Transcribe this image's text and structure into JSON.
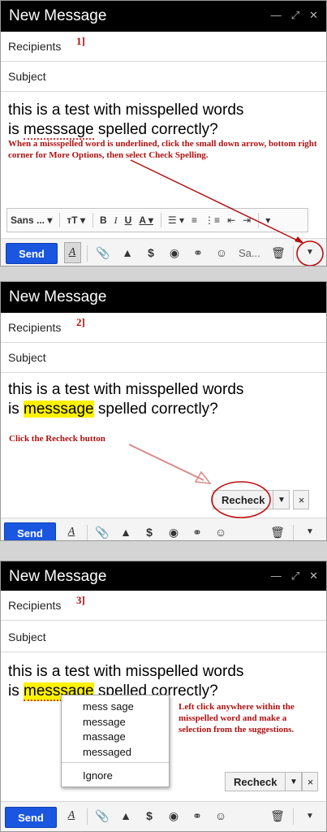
{
  "window_title": "New Message",
  "fields": {
    "recipients": "Recipients",
    "subject": "Subject"
  },
  "steps": [
    "1]",
    "2]",
    "3]"
  ],
  "body": {
    "line1": "this is a test with misspelled words",
    "line2_prefix": "is ",
    "misspelled": "messsage",
    "line2_suffix": " spelled correctly?"
  },
  "annotations": {
    "step1": "When a missspelled word is underlined, click the small down arrow, bottom right corner for More Options, then select Check Spelling.",
    "step2": "Click the Recheck button",
    "step3": "Left click anywhere within the misspelled word and make a selection from the suggestions."
  },
  "format_toolbar": {
    "font": "Sans ...",
    "size": "тT",
    "bold": "B",
    "italic": "I",
    "underline": "U",
    "text_color": "A"
  },
  "toolbar": {
    "send": "Send",
    "format_icon": "A",
    "dollar": "$",
    "sans_truncated": "Sa..."
  },
  "spellcheck": {
    "recheck": "Recheck",
    "close": "×"
  },
  "suggestions": [
    "mess sage",
    "message",
    "massage",
    "messaged"
  ],
  "ignore": "Ignore",
  "colors": {
    "send_blue": "#1a56e0",
    "annotation_red": "#b01010",
    "highlight_yellow": "#fff200",
    "title_black": "#000000"
  }
}
